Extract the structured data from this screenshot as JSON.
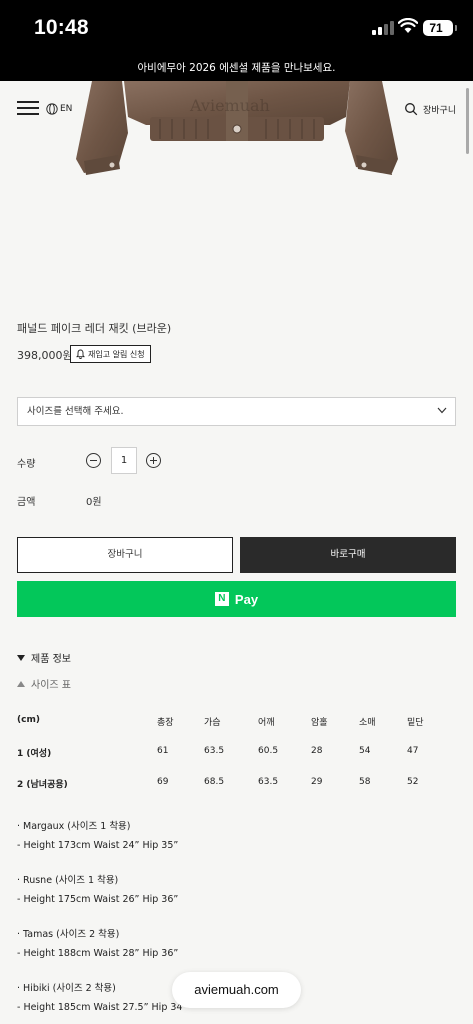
{
  "status_bar": {
    "time": "10:48",
    "battery": "71"
  },
  "announcement": "아비에무아 2026 에센셜 제품을 만나보세요.",
  "nav": {
    "lang": "EN",
    "cart": "장바구니",
    "brand_watermark": "Aviemuah"
  },
  "product": {
    "title": "패널드 페이크 레더 재킷 (브라운)",
    "price": "398,000원",
    "restock_button": "재입고 알림 신청",
    "size_select_placeholder": "사이즈를 선택해 주세요.",
    "quantity_label": "수량",
    "quantity_value": "1",
    "amount_label": "금액",
    "amount_value": "0원"
  },
  "buttons": {
    "cart": "장바구니",
    "buy_now": "바로구매",
    "npay": "Pay",
    "npay_logo": "N"
  },
  "sections": {
    "product_info": "제품 정보",
    "size_chart": "사이즈 표"
  },
  "size_table": {
    "headers": [
      "(cm)",
      "총장",
      "가슴",
      "어깨",
      "암홀",
      "소매",
      "밑단"
    ],
    "rows": [
      [
        "1 (여성)",
        "61",
        "63.5",
        "60.5",
        "28",
        "54",
        "47"
      ],
      [
        "2 (남녀공용)",
        "69",
        "68.5",
        "63.5",
        "29",
        "58",
        "52"
      ]
    ]
  },
  "models": [
    {
      "name": "· Margaux (사이즈 1 착용)",
      "measure": "- Height 173cm Waist 24” Hip 35”"
    },
    {
      "name": "· Rusne (사이즈 1 착용)",
      "measure": "- Height 175cm Waist 26” Hip 36”"
    },
    {
      "name": "· Tamas (사이즈 2 착용)",
      "measure": "- Height 188cm Waist 28” Hip 36”"
    },
    {
      "name": "· Hibiki (사이즈 2 착용)",
      "measure": "- Height 185cm Waist 27.5” Hip 34”"
    }
  ],
  "browser": {
    "domain": "aviemuah.com"
  },
  "colors": {
    "npay_green": "#03c75a",
    "buy_button": "#2a2a2a",
    "jacket_brown": "#7a6353"
  }
}
